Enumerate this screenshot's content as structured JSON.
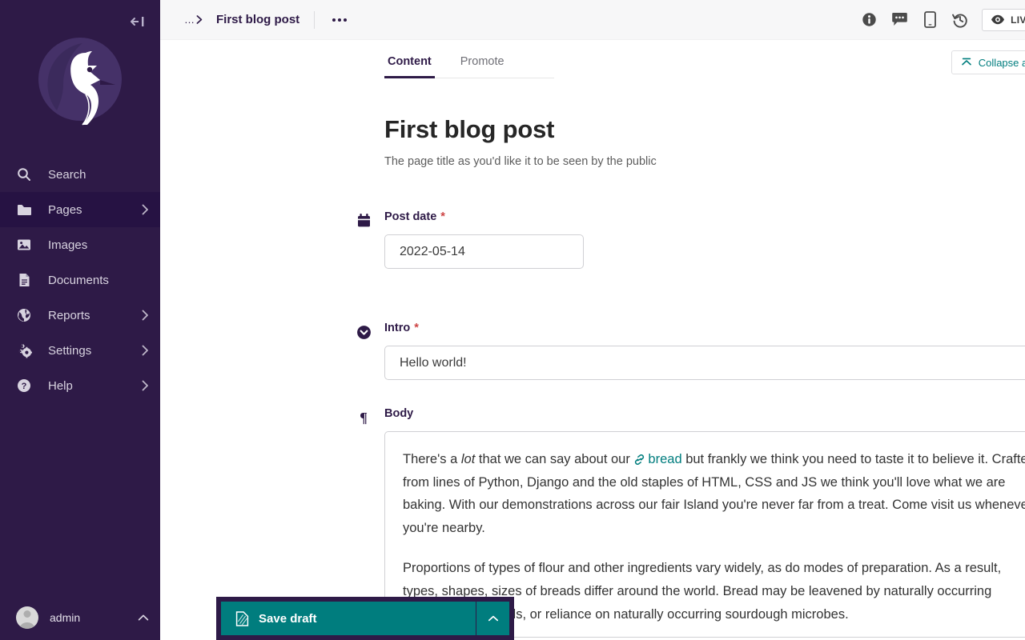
{
  "sidebar": {
    "collapse_icon": "collapse-sidebar-icon",
    "logo": "wagtail-bird-logo",
    "items": [
      {
        "label": "Search",
        "icon": "search-icon",
        "has_chevron": false,
        "active": false
      },
      {
        "label": "Pages",
        "icon": "folder-icon",
        "has_chevron": true,
        "active": true
      },
      {
        "label": "Images",
        "icon": "image-icon",
        "has_chevron": false,
        "active": false
      },
      {
        "label": "Documents",
        "icon": "document-icon",
        "has_chevron": false,
        "active": false
      },
      {
        "label": "Reports",
        "icon": "globe-icon",
        "has_chevron": true,
        "active": false
      },
      {
        "label": "Settings",
        "icon": "gear-icon",
        "has_chevron": true,
        "active": false
      },
      {
        "label": "Help",
        "icon": "question-circle-icon",
        "has_chevron": true,
        "active": false
      }
    ],
    "user": {
      "name": "admin",
      "avatar": "user-avatar",
      "chevron": "chevron-up-icon"
    }
  },
  "topbar": {
    "breadcrumb_ellipsis": "…",
    "title": "First blog post",
    "more_button": "…",
    "actions": [
      {
        "name": "info-icon",
        "label": ""
      },
      {
        "name": "comment-icon",
        "label": ""
      },
      {
        "name": "mobile-preview-icon",
        "label": ""
      },
      {
        "name": "history-icon",
        "label": ""
      }
    ],
    "live_label": "LIVE",
    "live_icon": "eye-icon"
  },
  "tabs": [
    {
      "label": "Content",
      "active": true
    },
    {
      "label": "Promote",
      "active": false
    }
  ],
  "collapse_all": {
    "label": "Collapse all",
    "icon": "collapse-icon"
  },
  "page": {
    "title": "First blog post",
    "subtitle": "The page title as you'd like it to be seen by the public"
  },
  "fields": {
    "post_date": {
      "label": "Post date",
      "required": "*",
      "icon": "calendar-icon",
      "value": "2022-05-14"
    },
    "intro": {
      "label": "Intro",
      "required": "*",
      "icon": "chevron-down-circle-icon",
      "value": "Hello world!"
    },
    "body": {
      "label": "Body",
      "icon": "pilcrow-icon",
      "paragraph1_a": "There's a ",
      "paragraph1_em": "lot",
      "paragraph1_b": " that we can say about our ",
      "paragraph1_link": "bread",
      "paragraph1_link_icon": "link-icon",
      "paragraph1_c": " but frankly we think you need to taste it to believe it. Crafted from lines of Python, Django and the old staples of HTML, CSS and JS we think you'll love what we are baking. With our demonstrations across our fair Island you're never far from a treat. Come visit us whenever you're nearby.",
      "paragraph2": "Proportions of types of flour and other ingredients vary widely, as do modes of preparation. As a result, types, shapes, sizes of breads differ around the world. Bread may be leavened by naturally occurring microbes, chemicals, or reliance on naturally occurring sourdough microbes."
    }
  },
  "minimap": {
    "dash_count": 5,
    "dash_offsets": [
      22,
      54,
      86,
      118,
      150
    ]
  },
  "action_bar": {
    "save_label": "Save draft",
    "save_icon": "draft-document-icon",
    "toggle_icon": "chevron-up-icon"
  },
  "colors": {
    "sidebar_bg": "#2e1a47",
    "sidebar_active": "#261243",
    "accent_teal": "#007d7e",
    "required_red": "#cd4444",
    "topbar_bg": "#f7f7f8"
  }
}
